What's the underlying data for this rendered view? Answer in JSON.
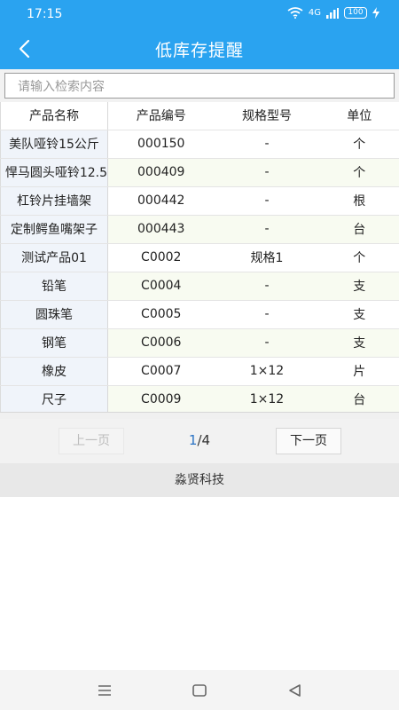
{
  "status": {
    "time": "17:15",
    "signal": "4G",
    "battery": "100"
  },
  "header": {
    "title": "低库存提醒"
  },
  "search": {
    "placeholder": "请输入检索内容"
  },
  "table": {
    "columns": [
      "产品名称",
      "产品编号",
      "规格型号",
      "单位"
    ],
    "rows": [
      [
        "美队哑铃15公斤",
        "000150",
        "-",
        "个"
      ],
      [
        "悍马圆头哑铃12.5",
        "000409",
        "-",
        "个"
      ],
      [
        "杠铃片挂墙架",
        "000442",
        "-",
        "根"
      ],
      [
        "定制鳄鱼嘴架子",
        "000443",
        "-",
        "台"
      ],
      [
        "测试产品01",
        "C0002",
        "规格1",
        "个"
      ],
      [
        "铅笔",
        "C0004",
        "-",
        "支"
      ],
      [
        "圆珠笔",
        "C0005",
        "-",
        "支"
      ],
      [
        "钢笔",
        "C0006",
        "-",
        "支"
      ],
      [
        "橡皮",
        "C0007",
        "1×12",
        "片"
      ],
      [
        "尺子",
        "C0009",
        "1×12",
        "台"
      ]
    ]
  },
  "pager": {
    "prev_label": "上一页",
    "next_label": "下一页",
    "current": "1",
    "total": "/4"
  },
  "footer": {
    "company": "淼贤科技"
  },
  "icons": {
    "back": "back-arrow-icon",
    "wifi": "wifi-icon",
    "signal": "signal-icon",
    "charging": "charging-icon",
    "menu": "menu-icon",
    "home": "home-icon",
    "back_nav": "back-triangle-icon"
  },
  "colors": {
    "header": "#2aa3f0",
    "page_current": "#2a73c4"
  }
}
